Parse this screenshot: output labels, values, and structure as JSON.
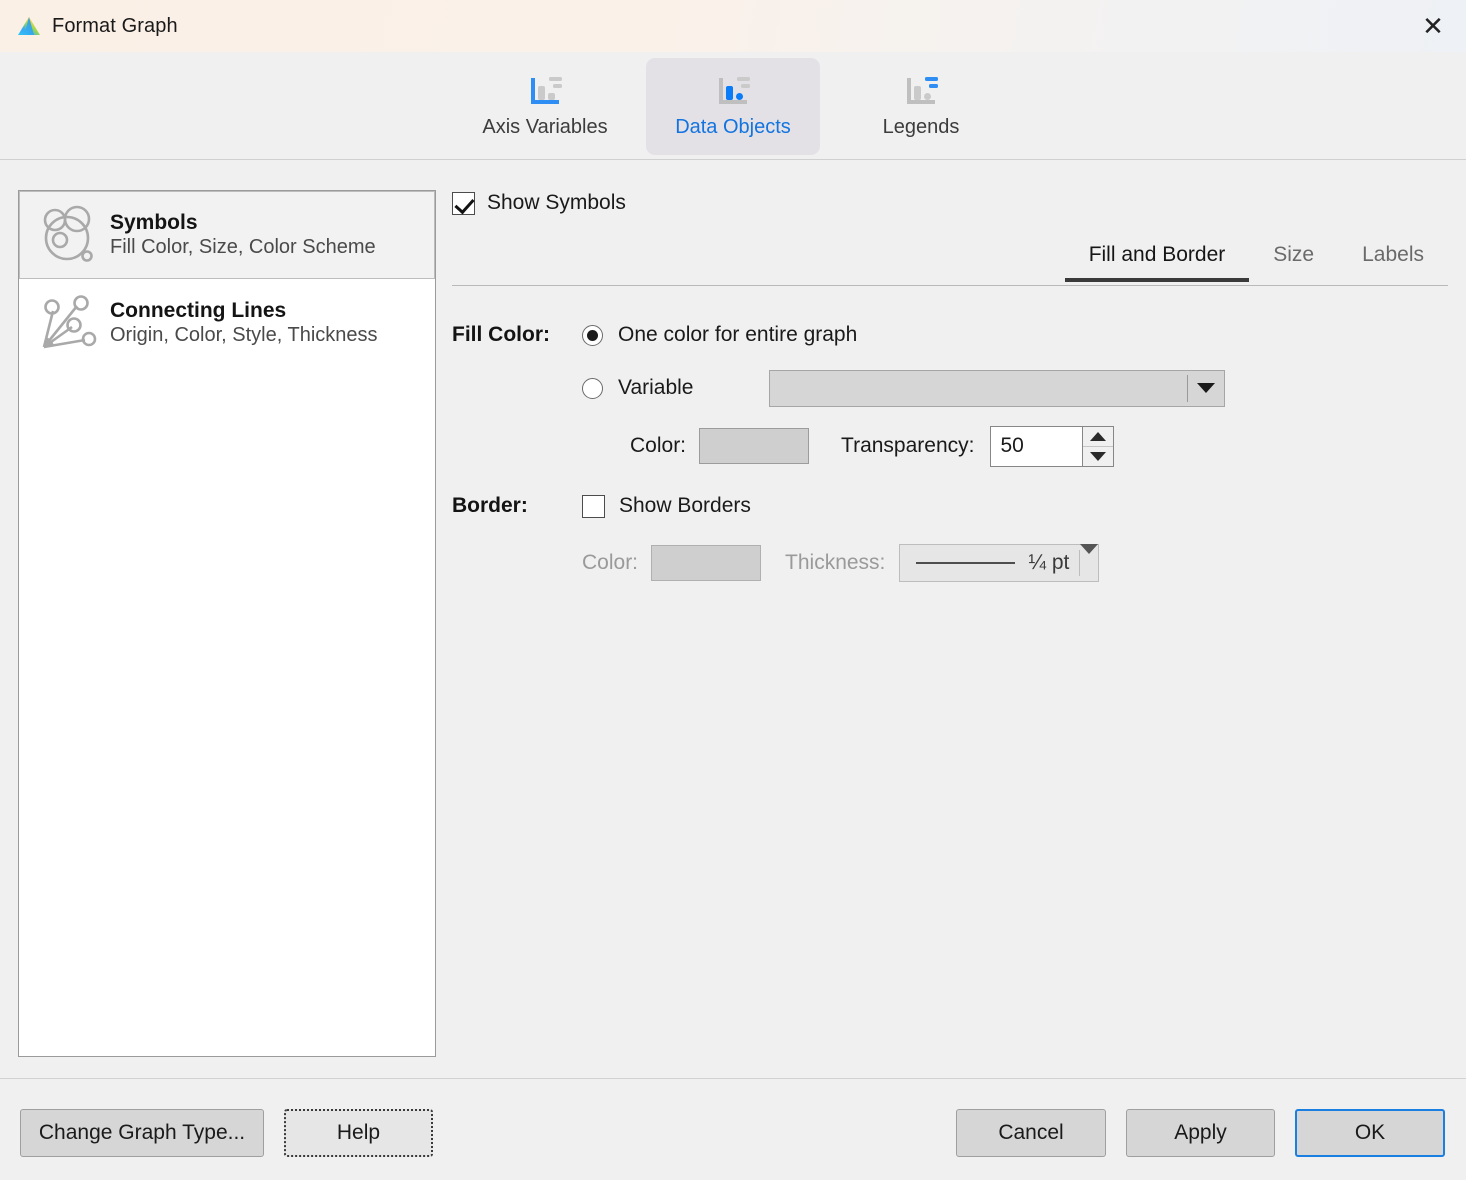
{
  "window": {
    "title": "Format Graph",
    "app_icon": "prism-triangle-icon",
    "close_label": "✕"
  },
  "tabs": [
    {
      "label": "Axis Variables",
      "icon": "axis-variables-icon",
      "active": false
    },
    {
      "label": "Data Objects",
      "icon": "data-objects-icon",
      "active": true
    },
    {
      "label": "Legends",
      "icon": "legends-icon",
      "active": false
    }
  ],
  "object_list": [
    {
      "title": "Symbols",
      "subtitle": "Fill Color, Size, Color Scheme",
      "icon": "symbols-circles-icon",
      "selected": true
    },
    {
      "title": "Connecting Lines",
      "subtitle": "Origin, Color, Style, Thickness",
      "icon": "connecting-lines-icon",
      "selected": false
    }
  ],
  "panel": {
    "show_symbols": {
      "label": "Show Symbols",
      "checked": true
    },
    "subtabs": [
      {
        "label": "Fill and Border",
        "active": true
      },
      {
        "label": "Size",
        "active": false
      },
      {
        "label": "Labels",
        "active": false
      }
    ],
    "fill_color": {
      "section_label": "Fill Color:",
      "option_one_color": "One color for entire graph",
      "option_variable": "Variable",
      "selected_option": "one_color",
      "variable_value": "",
      "variable_placeholder": "",
      "color_label": "Color:",
      "color_swatch": "#000000",
      "transparency_label": "Transparency:",
      "transparency_value": "50"
    },
    "border": {
      "section_label": "Border:",
      "show_borders_label": "Show Borders",
      "show_borders_checked": false,
      "color_label": "Color:",
      "color_swatch": "#595959",
      "thickness_label": "Thickness:",
      "thickness_value": "¼ pt",
      "enabled": false
    }
  },
  "footer": {
    "change_graph_type": "Change Graph Type...",
    "help": "Help",
    "cancel": "Cancel",
    "apply": "Apply",
    "ok": "OK"
  },
  "colors": {
    "accent_blue": "#1274e0",
    "titlebar_cream": "#faf0e6",
    "dialog_bg": "#f0f0f0"
  }
}
